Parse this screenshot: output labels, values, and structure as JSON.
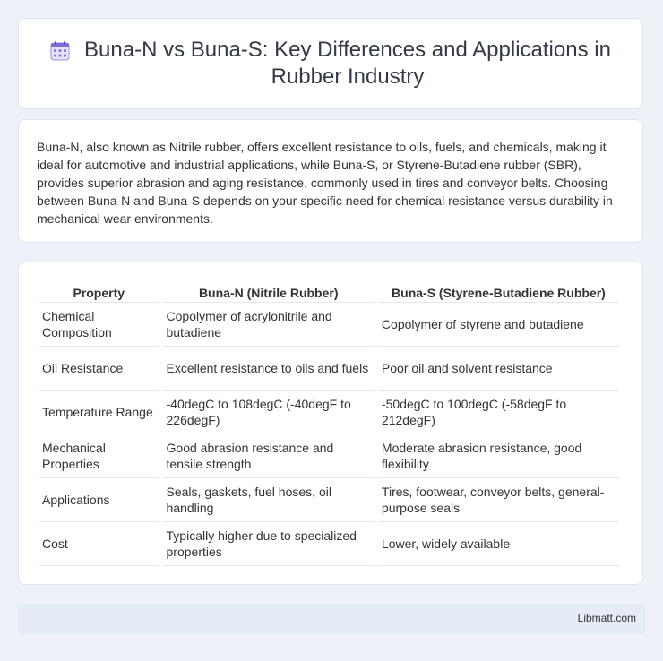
{
  "header": {
    "icon": "calendar-grid-icon",
    "title": "Buna-N vs Buna-S: Key Differences and Applications in Rubber Industry"
  },
  "intro": {
    "text": "Buna-N, also known as Nitrile rubber, offers excellent resistance to oils, fuels, and chemicals, making it ideal for automotive and industrial applications, while Buna-S, or Styrene-Butadiene rubber (SBR), provides superior abrasion and aging resistance, commonly used in tires and conveyor belts. Choosing between Buna-N and Buna-S depends on your specific need for chemical resistance versus durability in mechanical wear environments."
  },
  "table": {
    "headers": [
      "Property",
      "Buna-N (Nitrile Rubber)",
      "Buna-S (Styrene-Butadiene Rubber)"
    ],
    "rows": [
      [
        "Chemical Composition",
        "Copolymer of acrylonitrile and butadiene",
        "Copolymer of styrene and butadiene"
      ],
      [
        "Oil Resistance",
        "Excellent resistance to oils and fuels",
        "Poor oil and solvent resistance"
      ],
      [
        "Temperature Range",
        "-40degC to 108degC (-40degF to 226degF)",
        "-50degC to 100degC (-58degF to 212degF)"
      ],
      [
        "Mechanical Properties",
        "Good abrasion resistance and tensile strength",
        "Moderate abrasion resistance, good flexibility"
      ],
      [
        "Applications",
        "Seals, gaskets, fuel hoses, oil handling",
        "Tires, footwear, conveyor belts, general-purpose seals"
      ],
      [
        "Cost",
        "Typically higher due to specialized properties",
        "Lower, widely available"
      ]
    ]
  },
  "footer": {
    "brand": "Libmatt.com"
  },
  "colors": {
    "background": "#eef2f8",
    "card": "#ffffff",
    "footer": "#e6ecf6",
    "icon_accent": "#7b6fd6"
  }
}
